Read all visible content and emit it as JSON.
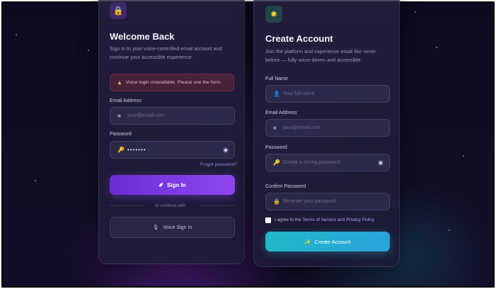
{
  "signin": {
    "icon": "lock-icon",
    "icon_glyph": "🔒",
    "title": "Welcome Back",
    "subtitle_line1": "Sign in to your voice-controlled email account and",
    "subtitle_line2": "continue your accessible experience.",
    "alert_glyph": "▲",
    "alert_text": "Voice login unavailable. Please use the form.",
    "email_label": "Email Address",
    "email_placeholder": "your@email.com",
    "email_glyph": "■",
    "password_label": "Password",
    "password_value": "•••••••",
    "password_glyph": "🔑",
    "forgot_label": "Forgot password?",
    "signin_button": "Sign In",
    "signin_glyph": "✐",
    "divider_text": "or continue with",
    "voice_button": "Voice Sign In",
    "voice_glyph": "🎙"
  },
  "signup": {
    "icon": "sparkle-icon",
    "icon_glyph": "✹",
    "title": "Create Account",
    "subtitle_line1": "Join the platform and experience email like never",
    "subtitle_line2": "before — fully voice-driven and accessible.",
    "name_label": "Full Name",
    "name_placeholder": "Your full name",
    "name_glyph": "👤",
    "email_label": "Email Address",
    "email_placeholder": "your@email.com",
    "email_glyph": "■",
    "password_label": "Password",
    "password_placeholder": "Create a strong password",
    "password_glyph": "🔑",
    "confirm_label": "Confirm Password",
    "confirm_placeholder": "Re-enter your password",
    "confirm_glyph": "🔒",
    "terms_prefix": "I agree to the",
    "terms_link": "Terms of Service and Privacy Policy",
    "create_button": "Create Account",
    "create_glyph": "✨"
  },
  "colors": {
    "primary": "#7b3ae6",
    "accent_teal": "#22b0d3",
    "background": "#0e0c22"
  }
}
